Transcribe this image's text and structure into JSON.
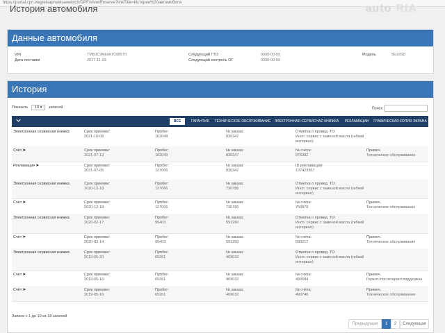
{
  "browser": {
    "url": "https://portal.cpn.vwg/elsapro/elsaweb/ctr/DPF/showReserve?linkTitle=История%20автомобиля"
  },
  "page": {
    "title": "История автомобиля",
    "watermark_a": "auto",
    "watermark_b": "RIA"
  },
  "vehicle": {
    "heading": "Данные автомобиля",
    "vin_label": "VIN",
    "vin_value": "TMBJC9NE6K0198570",
    "delivery_label": "Дата поставки",
    "delivery_value": "2017-11-23",
    "next_to_label": "Следующий ГТО",
    "next_to_value": "0000-00-00",
    "next_control_label": "Следующий контроль ОГ",
    "next_control_value": "0000-00-00",
    "model_label": "Модель",
    "model_value": "5E33SD"
  },
  "history": {
    "heading": "История",
    "show_label": "Показать",
    "page_size": "10",
    "entries_label": "записей",
    "search_label": "Поиск:",
    "tabs": [
      "ВСЕ",
      "ГАРАНТИЯ",
      "ТЕХНИЧЕСКОЕ ОБСЛУЖИВАНИЕ",
      "ЭЛЕКТРОННАЯ СЕРВИСНАЯ КНИЖКА",
      "РЕКЛАМАЦИИ",
      "ГРАФИЧЕСКАЯ КОПИЯ ЭКРАНА"
    ],
    "rows": [
      {
        "type": "Электронная сервисная книжка",
        "col2_label": "Срок приемки:",
        "col2_value": "2021-10-08",
        "col3_label": "Пробег:",
        "col3_value": "163049",
        "col4_label": "№ заказа:",
        "col4_value": "830347",
        "col5_label": "Отметка о провед. ТО:",
        "col5_value": "Инсп. сервис с заменой масла (гибкий интервал)",
        "col6_label": "",
        "col6_value": ""
      },
      {
        "type": "Счёт",
        "col2_label": "Срок приемки:",
        "col2_value": "2021-07-13",
        "col3_label": "Пробег:",
        "col3_value": "163049",
        "col4_label": "№ заказа:",
        "col4_value": "830347",
        "col5_label": "№ счёта:",
        "col5_value": "875392",
        "col6_label": "Примеч.",
        "col6_value": "Техническое обслуживание"
      },
      {
        "type": "Рекламация",
        "col2_label": "Срок приемки:",
        "col2_value": "2021-07-05",
        "col3_label": "Пробег:",
        "col3_value": "127066",
        "col4_label": "№ заказа:",
        "col4_value": "830347",
        "col5_label": "ID рекламации:",
        "col5_value": "137423367",
        "col6_label": "",
        "col6_value": ""
      },
      {
        "type": "Электронная сервисная книжка",
        "col2_label": "Срок приемки:",
        "col2_value": "2020-12-18",
        "col3_label": "Пробег:",
        "col3_value": "127066",
        "col4_label": "№ заказа:",
        "col4_value": "730786",
        "col5_label": "Отметка о провед. ТО:",
        "col5_value": "Инсп. сервис с заменой масла (гибкий интервал)",
        "col6_label": "",
        "col6_value": ""
      },
      {
        "type": "Счёт",
        "col2_label": "Срок приемки:",
        "col2_value": "2020-12-18",
        "col3_label": "Пробег:",
        "col3_value": "127066",
        "col4_label": "№ заказа:",
        "col4_value": "730786",
        "col5_label": "№ счёта:",
        "col5_value": "759878",
        "col6_label": "Примеч.",
        "col6_value": "Техническое обслуживание"
      },
      {
        "type": "Электронная сервисная книжка",
        "col2_label": "Срок приемки:",
        "col2_value": "2020-02-17",
        "col3_label": "Пробег:",
        "col3_value": "95403",
        "col4_label": "№ заказа:",
        "col4_value": "591260",
        "col5_label": "Отметка о провед. ТО:",
        "col5_value": "Инсп. сервис с заменой масла (гибкий интервал)",
        "col6_label": "",
        "col6_value": ""
      },
      {
        "type": "Счёт",
        "col2_label": "Срок приемки:",
        "col2_value": "2020-02-14",
        "col3_label": "Пробег:",
        "col3_value": "95403",
        "col4_label": "№ заказа:",
        "col4_value": "591260",
        "col5_label": "№ счёта:",
        "col5_value": "593217",
        "col6_label": "Примеч.",
        "col6_value": "Техническое обслуживание"
      },
      {
        "type": "Электронная сервисная книжка",
        "col2_label": "Срок приемки:",
        "col2_value": "2019-05-20",
        "col3_label": "Пробег:",
        "col3_value": "65261",
        "col4_label": "№ заказа:",
        "col4_value": "469032",
        "col5_label": "Отметка о провед. ТО:",
        "col5_value": "Инсп. сервис с заменой масла (гибкий интервал)",
        "col6_label": "",
        "col6_value": ""
      },
      {
        "type": "Счёт",
        "col2_label": "Срок приемки:",
        "col2_value": "2019-05-16",
        "col3_label": "Пробег:",
        "col3_value": "65261",
        "col4_label": "№ заказа:",
        "col4_value": "469032",
        "col5_label": "№ счёта:",
        "col5_value": "490684",
        "col6_label": "Примеч.",
        "col6_value": "Гарант./послегарант.поддержка"
      },
      {
        "type": "Счёт",
        "col2_label": "Срок приемки:",
        "col2_value": "2019-05-16",
        "col3_label": "Пробег:",
        "col3_value": "65261",
        "col4_label": "№ заказа:",
        "col4_value": "469032",
        "col5_label": "№ счёта:",
        "col5_value": "490740",
        "col6_label": "Примеч.",
        "col6_value": "Техническое обслуживание"
      }
    ],
    "footer_info": "Записи с 1 до 10 из 18 записей",
    "pager": {
      "prev": "Предыдущая",
      "p1": "1",
      "p2": "2",
      "next": "Следующая"
    }
  },
  "colors": {
    "header_blue": "#3a76b6",
    "tab_bar": "#1e3f66"
  }
}
